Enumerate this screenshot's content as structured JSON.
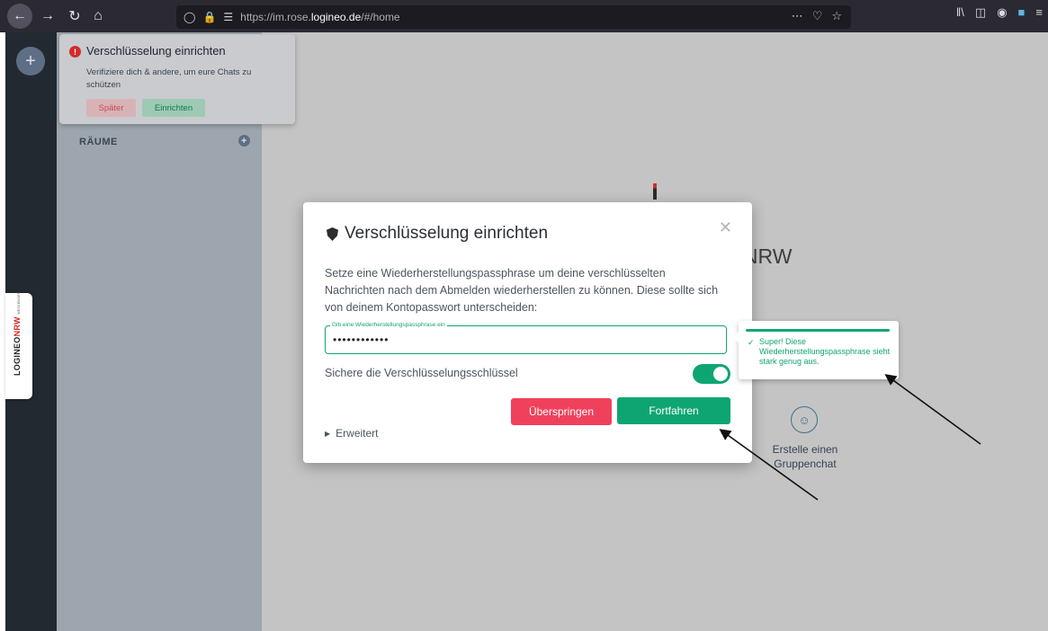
{
  "browser": {
    "url_prefix": "https://im.rose.",
    "url_domain": "logineo.de",
    "url_suffix": "/#/home",
    "icons": [
      "back-icon",
      "forward-icon",
      "reload-icon",
      "home-icon",
      "shield-icon",
      "lock-icon",
      "permissions-icon",
      "more-icon",
      "pocket-icon",
      "bookmark-star-icon",
      "library-icon",
      "sidebar-icon",
      "account-icon",
      "extension-icon",
      "menu-icon"
    ]
  },
  "toast": {
    "title": "Verschlüsselung einrichten",
    "text": "Verifiziere dich & andere, um eure Chats zu schützen",
    "later_label": "Später",
    "setup_label": "Einrichten"
  },
  "rooms": {
    "header": "RÄUME"
  },
  "brand": {
    "part1": "LOGINEO",
    "part2": "NRW",
    "part3": "MESSENGER"
  },
  "home": {
    "title_fragment": "NRW",
    "action_label": "Erstelle einen Gruppenchat"
  },
  "modal": {
    "title": "Verschlüsselung einrichten",
    "description": "Setze eine Wiederherstellungspassphrase um deine verschlüsselten Nachrichten nach dem Abmelden wiederherstellen zu können. Diese sollte sich von deinem Kontopasswort unterscheiden:",
    "field_label": "Gib eine Wiederherstellungspassphrase ein",
    "field_value": "••••••••••••",
    "toggle_label": "Sichere die Verschlüsselungsschlüssel",
    "toggle_on": true,
    "skip_label": "Überspringen",
    "continue_label": "Fortfahren",
    "advanced_label": "Erweitert"
  },
  "tooltip": {
    "text": "Super! Diese Wiederherstellungspassphrase sieht stark genug aus."
  },
  "colors": {
    "accent": "#0ea573",
    "danger": "#f0415c",
    "sidebar": "#232931"
  }
}
